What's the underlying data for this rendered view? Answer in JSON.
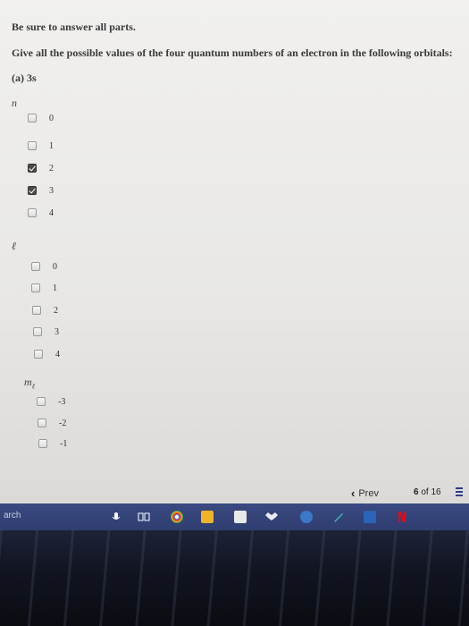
{
  "instruction": "Be sure to answer all parts.",
  "question": "Give all the possible values of the four quantum numbers of an electron in the following orbitals:",
  "part_label": "(a) 3s",
  "groups": {
    "n": {
      "label": "n",
      "options": [
        {
          "label": "0",
          "checked": false
        },
        {
          "label": "1",
          "checked": false
        },
        {
          "label": "2",
          "checked": true
        },
        {
          "label": "3",
          "checked": true
        },
        {
          "label": "4",
          "checked": false
        }
      ]
    },
    "l": {
      "label": "ℓ",
      "options": [
        {
          "label": "0",
          "checked": false
        },
        {
          "label": "1",
          "checked": false
        },
        {
          "label": "2",
          "checked": false
        },
        {
          "label": "3",
          "checked": false
        },
        {
          "label": "4",
          "checked": false
        }
      ]
    },
    "ml": {
      "label": "m",
      "sub": "ℓ",
      "options": [
        {
          "label": "-3",
          "checked": false
        },
        {
          "label": "-2",
          "checked": false
        },
        {
          "label": "-1",
          "checked": false
        }
      ]
    }
  },
  "nav": {
    "prev_label": "Prev",
    "page_current": "6",
    "page_of": "of",
    "page_total": "16"
  },
  "taskbar": {
    "search_text": "arch"
  }
}
